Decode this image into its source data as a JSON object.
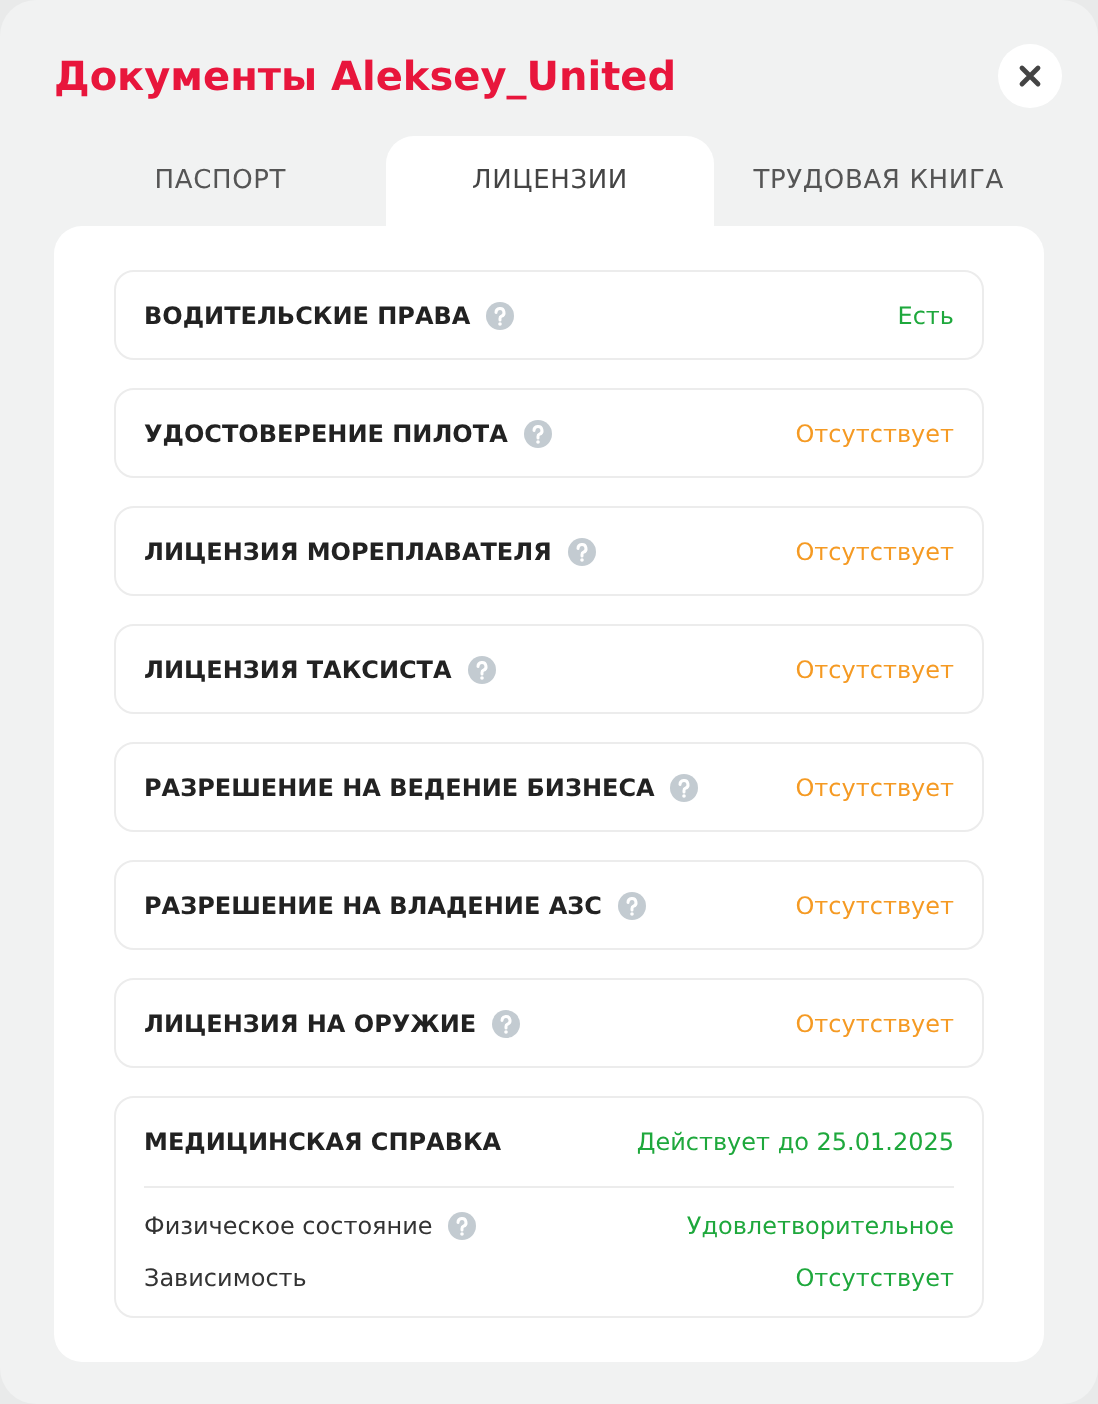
{
  "title": "Документы Aleksey_United",
  "tabs": [
    {
      "label": "ПАСПОРТ",
      "selected": false
    },
    {
      "label": "ЛИЦЕНЗИИ",
      "selected": true
    },
    {
      "label": "ТРУДОВАЯ КНИГА",
      "selected": false
    }
  ],
  "licenses": [
    {
      "name": "ВОДИТЕЛЬСКИЕ ПРАВА",
      "status": "Есть",
      "color": "#1ea83c"
    },
    {
      "name": "УДОСТОВЕРЕНИЕ ПИЛОТА",
      "status": "Отсутствует",
      "color": "#f59a23"
    },
    {
      "name": "ЛИЦЕНЗИЯ МОРЕПЛАВАТЕЛЯ",
      "status": "Отсутствует",
      "color": "#f59a23"
    },
    {
      "name": "ЛИЦЕНЗИЯ ТАКСИСТА",
      "status": "Отсутствует",
      "color": "#f59a23"
    },
    {
      "name": "РАЗРЕШЕНИЕ НА ВЕДЕНИЕ БИЗНЕСА",
      "status": "Отсутствует",
      "color": "#f59a23"
    },
    {
      "name": "РАЗРЕШЕНИЕ НА ВЛАДЕНИЕ АЗС",
      "status": "Отсутствует",
      "color": "#f59a23"
    },
    {
      "name": "ЛИЦЕНЗИЯ НА ОРУЖИЕ",
      "status": "Отсутствует",
      "color": "#f59a23"
    }
  ],
  "medical": {
    "name": "МЕДИЦИНСКАЯ СПРАВКА",
    "status": "Действует до 25.01.2025",
    "color": "#1ea83c",
    "details": [
      {
        "label": "Физическое состояние",
        "help": true,
        "value": "Удовлетворительное"
      },
      {
        "label": "Зависимость",
        "help": false,
        "value": "Отсутствует"
      }
    ]
  }
}
